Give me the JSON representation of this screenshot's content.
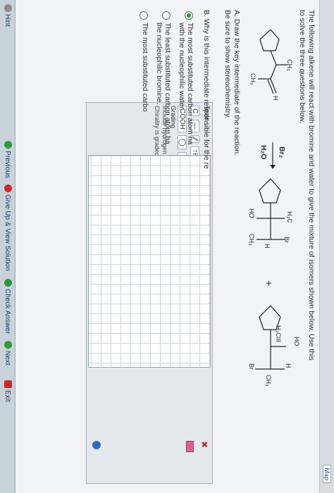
{
  "header": {
    "map_label": "Map"
  },
  "question": {
    "prompt_line1": "The following alkene will react with bromine and water to give the mixture of isomers shown below. Use this",
    "prompt_line2": "to solve the three questions below.",
    "reagent_top": "Br₂",
    "reagent_bottom": "H₂O",
    "plus": "+"
  },
  "structures": {
    "reactant": {
      "ch3_top": "CH₃",
      "h": "H",
      "ch3_bottom": "CH₃"
    },
    "product1": {
      "h3c": "H₃C",
      "br": "Br",
      "ho": "HO",
      "h": "H",
      "ch3": "CH₃"
    },
    "product2": {
      "ho": "HO",
      "h3cii": "H₃CIII",
      "h": "H",
      "ch3": "CH₃",
      "br": "Br"
    }
  },
  "part_a": {
    "line1": "A. Draw the key intermediate of the reaction.",
    "line2": "Be sure to show stereochemistry."
  },
  "tools_panel": {
    "title": "Tools",
    "row1": [
      "C",
      "—",
      "⁄⁄",
      "↑H",
      "⌒"
    ],
    "row2": [
      "COOH",
      "◯",
      "'''",
      "↓H"
    ],
    "grading_label": "Grading",
    "grading_line1": "Include hydrogen atoms on non-carbon atoms.",
    "grading_line2": "Chirality is graded: include hydrogens on chirality centers."
  },
  "part_b": {
    "question": "B. Why is this intermediate responsible for the re",
    "options": [
      {
        "line1": "The most substituted carbon atom ha",
        "line2": "with the nucleophilic water."
      },
      {
        "line1": "The least substituted carbon atom ha",
        "line2": "the nucleophilic bromine."
      },
      {
        "line1": "The most substituted carbo",
        "line2": ""
      }
    ]
  },
  "footer": {
    "hint": "Hint",
    "previous": "Previous",
    "give_up": "Give Up & View Solution",
    "check": "Check Answer",
    "next": "Next",
    "exit": "Exit"
  },
  "colors": {
    "accent": "#2a9a3a",
    "error": "#cc2a2a",
    "link": "#1d3b6e"
  }
}
